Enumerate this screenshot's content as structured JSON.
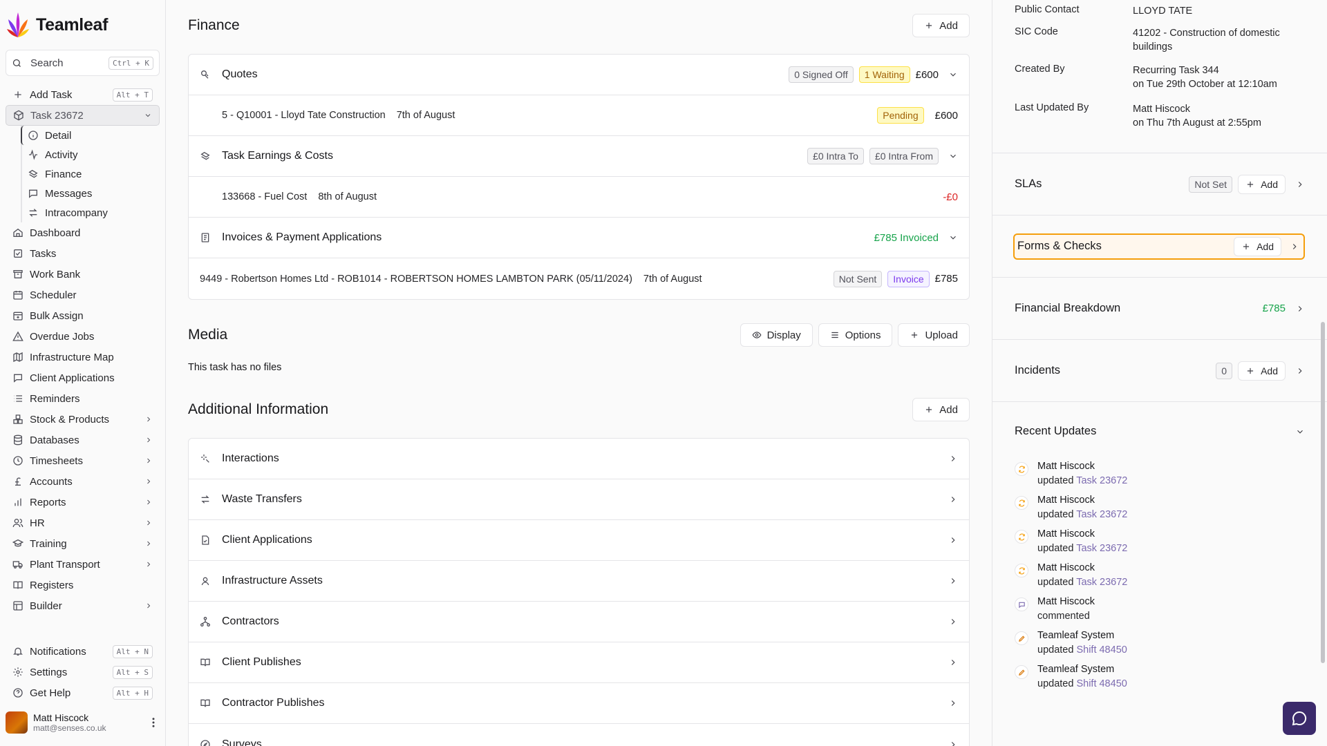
{
  "brand": {
    "name": "Teamleaf"
  },
  "search": {
    "label": "Search",
    "shortcut": "Ctrl + K"
  },
  "sidebar": {
    "add_task": {
      "label": "Add Task",
      "shortcut": "Alt + T"
    },
    "task": {
      "label": "Task 23672"
    },
    "task_sub": [
      "Detail",
      "Activity",
      "Finance",
      "Messages",
      "Intracompany"
    ],
    "items": [
      {
        "label": "Dashboard"
      },
      {
        "label": "Tasks"
      },
      {
        "label": "Work Bank"
      },
      {
        "label": "Scheduler"
      },
      {
        "label": "Bulk Assign"
      },
      {
        "label": "Overdue Jobs"
      },
      {
        "label": "Infrastructure Map"
      },
      {
        "label": "Client Applications"
      },
      {
        "label": "Reminders"
      },
      {
        "label": "Stock & Products"
      },
      {
        "label": "Databases"
      },
      {
        "label": "Timesheets"
      },
      {
        "label": "Accounts"
      },
      {
        "label": "Reports"
      },
      {
        "label": "HR"
      },
      {
        "label": "Training"
      },
      {
        "label": "Plant Transport"
      },
      {
        "label": "Registers"
      },
      {
        "label": "Builder"
      }
    ],
    "bottom": [
      {
        "label": "Notifications",
        "shortcut": "Alt + N"
      },
      {
        "label": "Settings",
        "shortcut": "Alt + S"
      },
      {
        "label": "Get Help",
        "shortcut": "Alt + H"
      }
    ],
    "user": {
      "name": "Matt Hiscock",
      "email": "matt@senses.co.uk"
    }
  },
  "finance": {
    "title": "Finance",
    "add_label": "Add",
    "quotes": {
      "title": "Quotes",
      "signed_off": "0 Signed Off",
      "waiting": "1 Waiting",
      "total": "£600"
    },
    "quote_item": {
      "name": "5 - Q10001 - Lloyd Tate Construction",
      "date": "7th of August",
      "status": "Pending",
      "amount": "£600"
    },
    "earnings": {
      "title": "Task Earnings & Costs",
      "intra_to": "£0 Intra To",
      "intra_from": "£0 Intra From"
    },
    "cost_item": {
      "name": "133668 - Fuel Cost",
      "date": "8th of August",
      "amount": "-£0"
    },
    "invoices": {
      "title": "Invoices & Payment Applications",
      "invoiced": "£785 Invoiced"
    },
    "invoice_item": {
      "name": "9449 - Robertson Homes Ltd - ROB1014 - ROBERTSON HOMES LAMBTON PARK (05/11/2024)",
      "date": "7th of August",
      "status": "Not Sent",
      "type": "Invoice",
      "amount": "£785"
    }
  },
  "media": {
    "title": "Media",
    "display": "Display",
    "options": "Options",
    "upload": "Upload",
    "empty": "This task has no files"
  },
  "additional": {
    "title": "Additional Information",
    "add_label": "Add",
    "items": [
      "Interactions",
      "Waste Transfers",
      "Client Applications",
      "Infrastructure Assets",
      "Contractors",
      "Client Publishes",
      "Contractor Publishes",
      "Surveys"
    ]
  },
  "details": {
    "public_contact": {
      "key": "Public Contact",
      "value": "LLOYD TATE"
    },
    "sic_code": {
      "key": "SIC Code",
      "value": "41202 - Construction of domestic buildings"
    },
    "created_by": {
      "key": "Created By",
      "value": "Recurring Task 344",
      "when": "on Tue 29th October at 12:10am"
    },
    "last_updated_by": {
      "key": "Last Updated By",
      "value": "Matt Hiscock",
      "when": "on Thu 7th August at 2:55pm"
    }
  },
  "slas": {
    "title": "SLAs",
    "status": "Not Set",
    "add_label": "Add"
  },
  "forms": {
    "title": "Forms & Checks",
    "add_label": "Add"
  },
  "financial_breakdown": {
    "title": "Financial Breakdown",
    "amount": "£785"
  },
  "incidents": {
    "title": "Incidents",
    "count": "0",
    "add_label": "Add"
  },
  "recent_updates": {
    "title": "Recent Updates",
    "items": [
      {
        "who": "Matt Hiscock",
        "verb": "updated",
        "target": "Task 23672",
        "kind": "sync"
      },
      {
        "who": "Matt Hiscock",
        "verb": "updated",
        "target": "Task 23672",
        "kind": "sync"
      },
      {
        "who": "Matt Hiscock",
        "verb": "updated",
        "target": "Task 23672",
        "kind": "sync"
      },
      {
        "who": "Matt Hiscock",
        "verb": "updated",
        "target": "Task 23672",
        "kind": "sync"
      },
      {
        "who": "Matt Hiscock",
        "verb": "commented",
        "target": "",
        "kind": "comment"
      },
      {
        "who": "Teamleaf System",
        "verb": "updated",
        "target": "Shift 48450",
        "kind": "edit"
      },
      {
        "who": "Teamleaf System",
        "verb": "updated",
        "target": "Shift 48450",
        "kind": "edit"
      }
    ]
  },
  "colors": {
    "accent": "#7c6bb0",
    "highlight": "#f59e0b",
    "success": "#16a34a",
    "danger": "#dc2626",
    "chat": "#3b2a6b"
  }
}
